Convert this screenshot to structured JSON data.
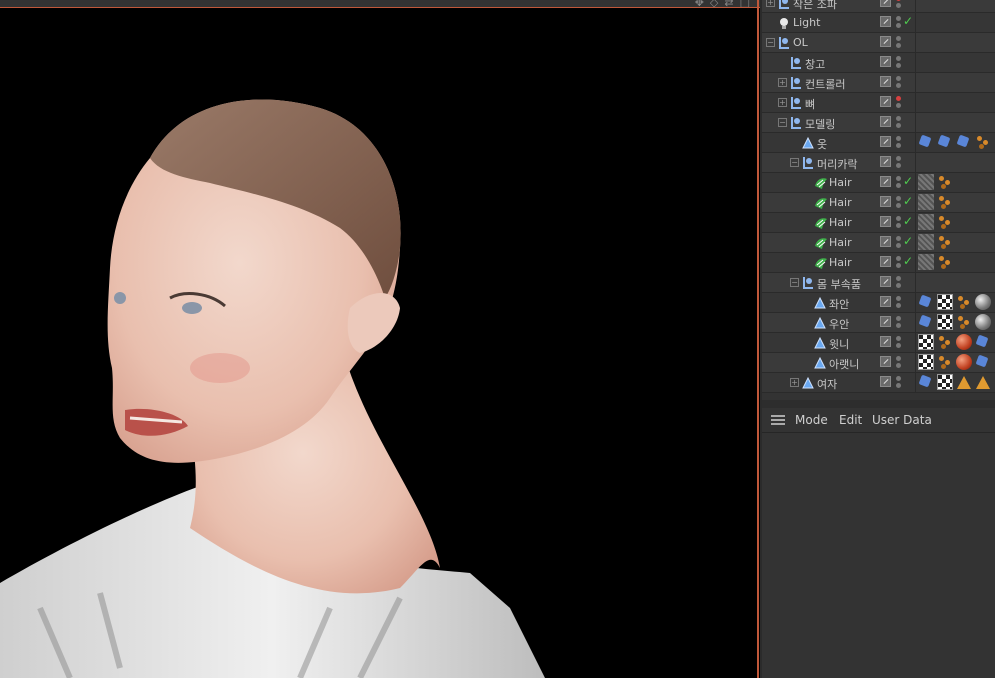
{
  "viewport": {
    "label": "3D viewport"
  },
  "objects": [
    {
      "name": "작은 조파",
      "depth": 0,
      "type": "null",
      "exp": "+",
      "dots": "red",
      "check": false,
      "tags": []
    },
    {
      "name": "Light",
      "depth": 0,
      "type": "light",
      "exp": "",
      "dots": "grey",
      "check": true,
      "tags": []
    },
    {
      "name": "OL",
      "depth": 0,
      "type": "null",
      "exp": "-",
      "dots": "grey",
      "check": false,
      "tags": []
    },
    {
      "name": "창고",
      "depth": 1,
      "type": "null",
      "exp": "",
      "dots": "grey",
      "check": false,
      "tags": []
    },
    {
      "name": "컨트롤러",
      "depth": 1,
      "type": "null",
      "exp": "+",
      "dots": "grey",
      "check": false,
      "tags": []
    },
    {
      "name": "뼈",
      "depth": 1,
      "type": "null",
      "exp": "+",
      "dots": "red",
      "check": false,
      "tags": []
    },
    {
      "name": "모델링",
      "depth": 1,
      "type": "null",
      "exp": "-",
      "dots": "grey",
      "check": false,
      "tags": []
    },
    {
      "name": "옷",
      "depth": 2,
      "type": "poly",
      "exp": "",
      "dots": "grey",
      "check": false,
      "tags": [
        "blue",
        "blue",
        "blue",
        "orbs"
      ]
    },
    {
      "name": "머리카락",
      "depth": 2,
      "type": "null",
      "exp": "-",
      "dots": "grey",
      "check": false,
      "tags": []
    },
    {
      "name": "Hair",
      "depth": 3,
      "type": "hair",
      "exp": "",
      "dots": "grey",
      "check": true,
      "tags": [
        "hatch",
        "orbs"
      ]
    },
    {
      "name": "Hair",
      "depth": 3,
      "type": "hair",
      "exp": "",
      "dots": "grey",
      "check": true,
      "tags": [
        "hatch",
        "orbs"
      ]
    },
    {
      "name": "Hair",
      "depth": 3,
      "type": "hair",
      "exp": "",
      "dots": "grey",
      "check": true,
      "tags": [
        "hatch",
        "orbs"
      ]
    },
    {
      "name": "Hair",
      "depth": 3,
      "type": "hair",
      "exp": "",
      "dots": "grey",
      "check": true,
      "tags": [
        "hatch",
        "orbs"
      ]
    },
    {
      "name": "Hair",
      "depth": 3,
      "type": "hair",
      "exp": "",
      "dots": "grey",
      "check": true,
      "tags": [
        "hatch",
        "orbs"
      ]
    },
    {
      "name": "몸 부속품",
      "depth": 2,
      "type": "null",
      "exp": "-",
      "dots": "grey",
      "check": false,
      "tags": []
    },
    {
      "name": "좌안",
      "depth": 3,
      "type": "poly",
      "exp": "",
      "dots": "grey",
      "check": false,
      "tags": [
        "blue",
        "checker",
        "orbs",
        "sphere"
      ]
    },
    {
      "name": "우안",
      "depth": 3,
      "type": "poly",
      "exp": "",
      "dots": "grey",
      "check": false,
      "tags": [
        "blue",
        "checker",
        "orbs",
        "sphere"
      ]
    },
    {
      "name": "윗니",
      "depth": 3,
      "type": "poly",
      "exp": "",
      "dots": "grey",
      "check": false,
      "tags": [
        "checker",
        "orbs",
        "redsphere",
        "blue"
      ]
    },
    {
      "name": "아랫니",
      "depth": 3,
      "type": "poly",
      "exp": "",
      "dots": "grey",
      "check": false,
      "tags": [
        "checker",
        "orbs",
        "redsphere",
        "blue"
      ]
    },
    {
      "name": "여자",
      "depth": 2,
      "type": "poly",
      "exp": "+",
      "dots": "grey",
      "check": false,
      "tags": [
        "blue",
        "checker",
        "tri",
        "tri"
      ]
    }
  ],
  "attributes": {
    "menu": [
      "Mode",
      "Edit",
      "User Data"
    ]
  },
  "colors": {
    "accent": "#c0583a",
    "check": "#4ecb4e"
  }
}
